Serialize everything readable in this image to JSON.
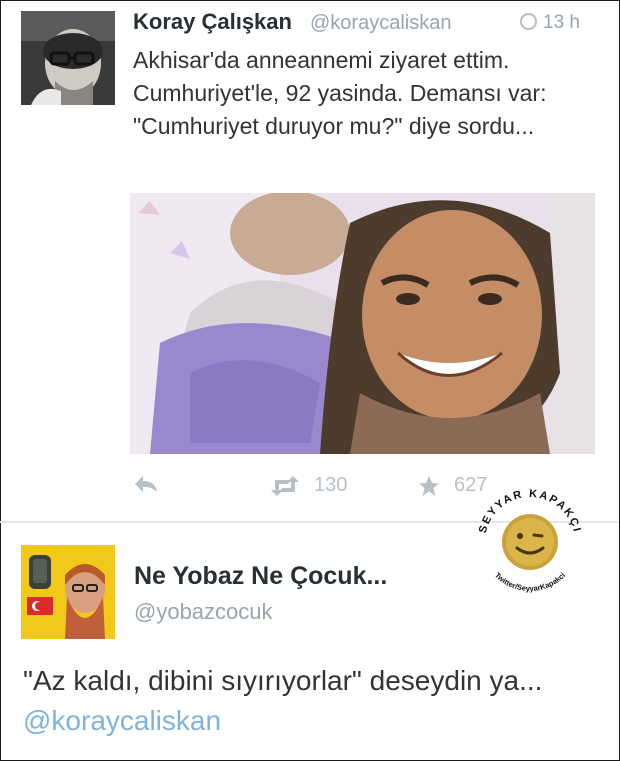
{
  "tweet1": {
    "author_name": "Koray Çalışkan",
    "author_handle": "@koraycaliskan",
    "time": "13 h",
    "text": "Akhisar'da anneannemi ziyaret ettim. Cumhuriyet'le, 92 yasinda. Demansı var: \"Cumhuriyet duruyor mu?\" diye sordu...",
    "actions": {
      "reply_icon": "reply-icon",
      "retweet_icon": "retweet-icon",
      "retweet_count": "130",
      "favorite_icon": "star-icon",
      "favorite_count": "627"
    }
  },
  "tweet2": {
    "author_name": "Ne Yobaz Ne Çocuk...",
    "author_handle": "@yobazcocuk",
    "text_before": "\"Az kaldı, dibini sıyırıyorlar\" deseydin ya... ",
    "mention": "@koraycaliskan"
  },
  "watermark": {
    "top_text": "SEYYAR KAPAKÇI",
    "bottom_text": "Twitter/SeyyarKapakci"
  },
  "colors": {
    "name_text": "#292f33",
    "muted_text": "#9aa4ad",
    "mention": "#7fb3de",
    "divider": "#e2e6ea",
    "stamp_gold": "#c9a23a"
  }
}
